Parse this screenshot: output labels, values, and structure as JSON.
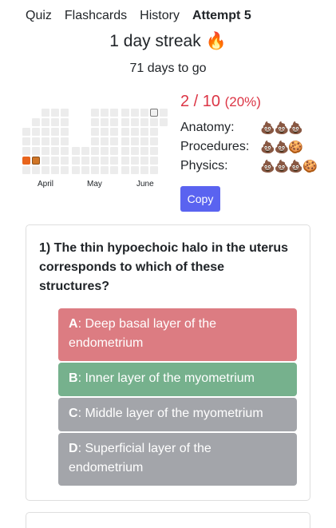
{
  "nav": {
    "quiz": "Quiz",
    "flashcards": "Flashcards",
    "history": "History",
    "attempt": "Attempt 5"
  },
  "streak": {
    "text": "1 day streak",
    "icon": "🔥",
    "to_go": "71 days to go"
  },
  "heatmap": {
    "months": [
      "April",
      "May",
      "June"
    ],
    "active_days": 2,
    "colors": {
      "empty": "#ececec",
      "active": "#e8641c"
    }
  },
  "score": {
    "text": "2 / 10",
    "percent": "(20%)",
    "color": "#dc3545"
  },
  "categories": [
    {
      "label": "Anatomy:",
      "icons": "💩💩💩"
    },
    {
      "label": "Procedures:",
      "icons": "💩💩🍪"
    },
    {
      "label": "Physics:",
      "icons": "💩💩💩🍪"
    }
  ],
  "copy_button": "Copy",
  "question": {
    "text": "1) The thin hypoechoic halo in the uterus corresponds to which of these structures?",
    "answers": [
      {
        "letter": "A",
        "text": ": Deep basal layer of the endometrium",
        "status": "incorrect"
      },
      {
        "letter": "B",
        "text": ": Inner layer of the myometrium",
        "status": "correct"
      },
      {
        "letter": "C",
        "text": ": Middle layer of the myometrium",
        "status": "neutral"
      },
      {
        "letter": "D",
        "text": ": Superficial layer of the endometrium",
        "status": "neutral"
      }
    ]
  },
  "colors": {
    "incorrect": "#dc7c82",
    "correct": "#76b18d",
    "neutral": "#a3a5aa",
    "button": "#5a63f0"
  }
}
